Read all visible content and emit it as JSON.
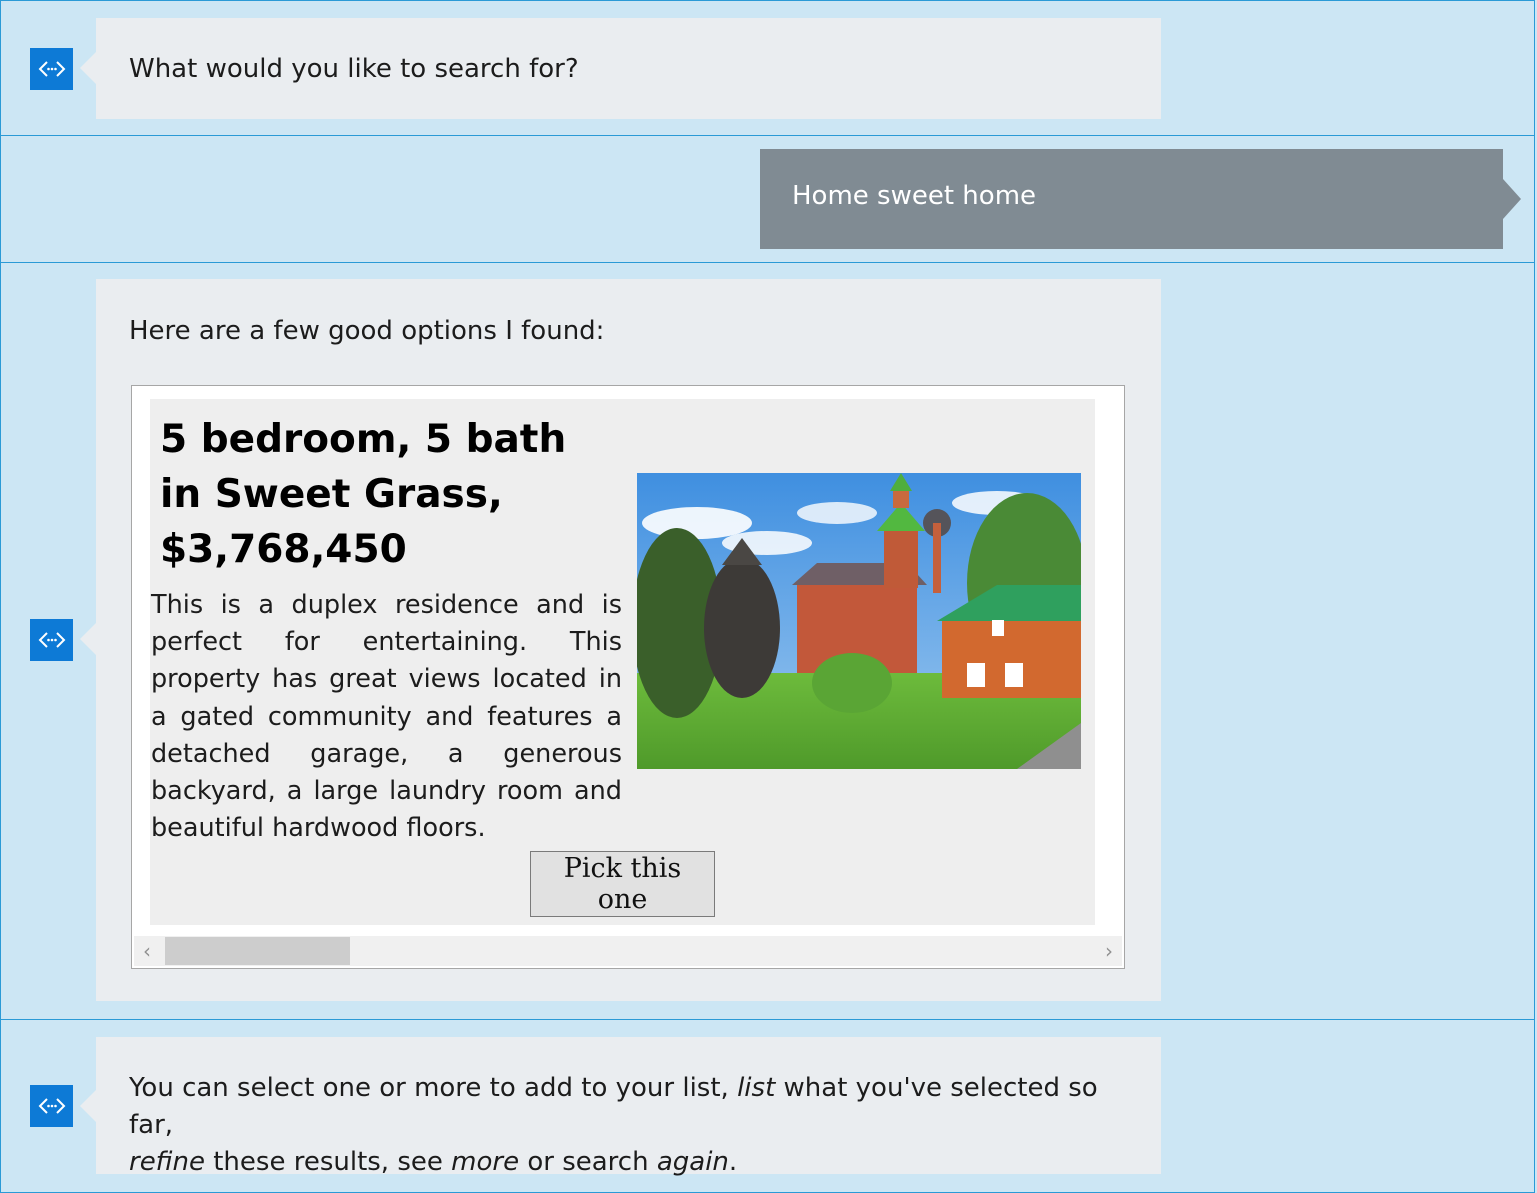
{
  "messages": [
    {
      "from": "bot",
      "text": "What would you like to search for?"
    },
    {
      "from": "user",
      "text": "Home sweet home"
    },
    {
      "from": "bot",
      "text": "Here are a few good options I found:"
    },
    {
      "from": "bot",
      "text_plain_1": "You can select one or more to add to your list, ",
      "em_list": "list",
      "text_plain_2": " what you've selected so far,",
      "em_refine": "refine",
      "text_plain_3": " these results, see ",
      "em_more": "more",
      "text_plain_4": " or search ",
      "em_again": "again",
      "text_plain_5": "."
    }
  ],
  "card": {
    "title": "5 bedroom, 5 bath in Sweet Grass, $3,768,450",
    "description": "This is a duplex residence and is perfect for entertaining. This property has great views located in a gated community and features a detached garage, a generous backyard, a large laundry room and beautiful hardwood floors.",
    "button_label": "Pick this one"
  },
  "scrollbar": {
    "left_arrow": "‹",
    "right_arrow": "›"
  },
  "icons": {
    "bot_avatar": "bot-code-icon"
  },
  "colors": {
    "background": "#cce6f4",
    "row_border": "#2a9ad6",
    "bot_bubble": "#eaedf0",
    "user_bubble": "#808b93",
    "avatar": "#0d7ad6"
  }
}
